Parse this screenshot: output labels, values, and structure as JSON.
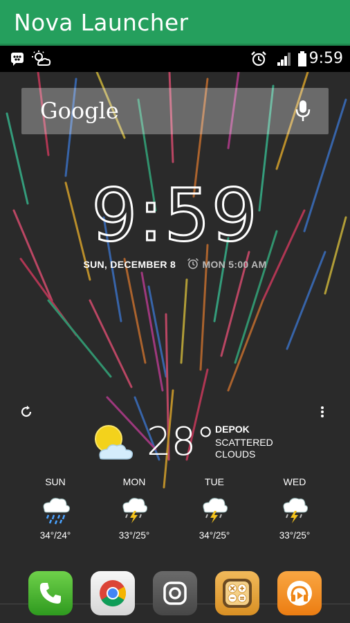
{
  "app_title": "Nova Launcher",
  "status_bar": {
    "time": "9:59",
    "left_icons": [
      "bbm-chat-icon",
      "partly-cloudy-icon"
    ],
    "right_icons": [
      "alarm-clock-icon",
      "signal-bars-icon",
      "battery-icon"
    ]
  },
  "search": {
    "label": "Google",
    "mic_icon": "microphone-icon"
  },
  "clock": {
    "hours": "9",
    "colon": ":",
    "minutes": "59",
    "date": "SUN, DECEMBER 8",
    "alarm": "MON 5:00 AM"
  },
  "weather": {
    "temperature": "28°",
    "location": "DEPOK",
    "condition_line1": "SCATTERED",
    "condition_line2": "CLOUDS",
    "forecast": [
      {
        "day": "SUN",
        "range": "34°/24°",
        "icon": "rain-cloud-icon"
      },
      {
        "day": "MON",
        "range": "33°/25°",
        "icon": "thunderstorm-icon"
      },
      {
        "day": "TUE",
        "range": "34°/25°",
        "icon": "thunderstorm-icon"
      },
      {
        "day": "WED",
        "range": "33°/25°",
        "icon": "thunderstorm-icon"
      }
    ]
  },
  "dock": [
    {
      "name": "phone",
      "icon": "phone-icon",
      "color": "#3fae2b"
    },
    {
      "name": "chrome",
      "icon": "chrome-icon",
      "color": "#e8e8e8"
    },
    {
      "name": "camera",
      "icon": "camera-icon",
      "color": "#5a5a5a"
    },
    {
      "name": "calculator",
      "icon": "calculator-icon",
      "color": "#e8a33a"
    },
    {
      "name": "music",
      "icon": "headphones-icon",
      "color": "#f08a1c"
    }
  ],
  "colors": {
    "title_bar": "#259f5d",
    "status_bar": "#000000",
    "wallpaper": "#2a2a2a"
  }
}
